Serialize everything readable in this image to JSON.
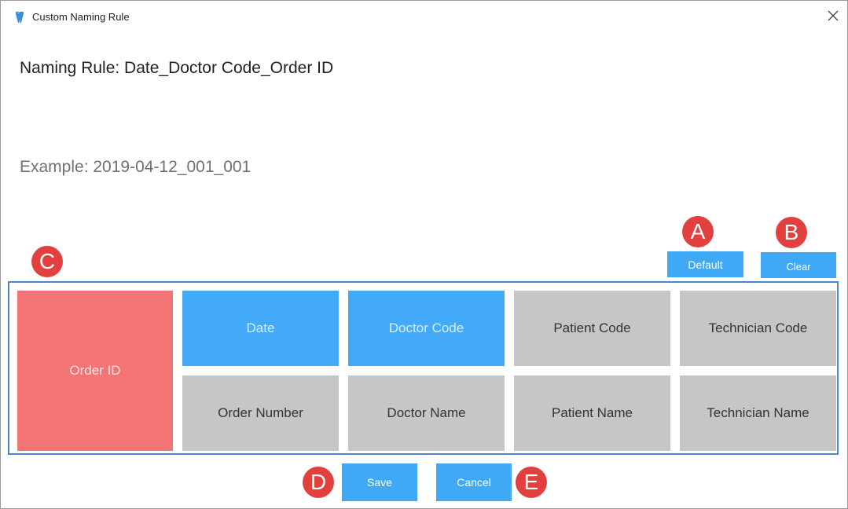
{
  "window": {
    "title": "Custom Naming Rule",
    "close_glyph": "✕"
  },
  "naming_rule": {
    "heading": "Naming Rule: Date_Doctor Code_Order ID"
  },
  "example": {
    "text": "Example: 2019-04-12_001_001"
  },
  "buttons": {
    "default_label": "Default",
    "clear_label": "Clear",
    "save_label": "Save",
    "cancel_label": "Cancel"
  },
  "markers": {
    "a": "A",
    "b": "B",
    "c": "C",
    "d": "D",
    "e": "E"
  },
  "tiles": {
    "order_id": "Order ID",
    "date": "Date",
    "doctor_code": "Doctor Code",
    "patient_code": "Patient Code",
    "technician_code": "Technician Code",
    "order_number": "Order Number",
    "doctor_name": "Doctor Name",
    "patient_name": "Patient Name",
    "technician_name": "Technician Name"
  },
  "colors": {
    "selected_blue": "#42aaf8",
    "selected_red": "#f27474",
    "unselected_gray": "#c6c6c6",
    "button_blue": "#3fa9f5",
    "marker_red": "#e2403f",
    "frame_blue": "#4a86c8"
  },
  "icons": {
    "app": "tooth-icon",
    "close": "close-icon"
  }
}
